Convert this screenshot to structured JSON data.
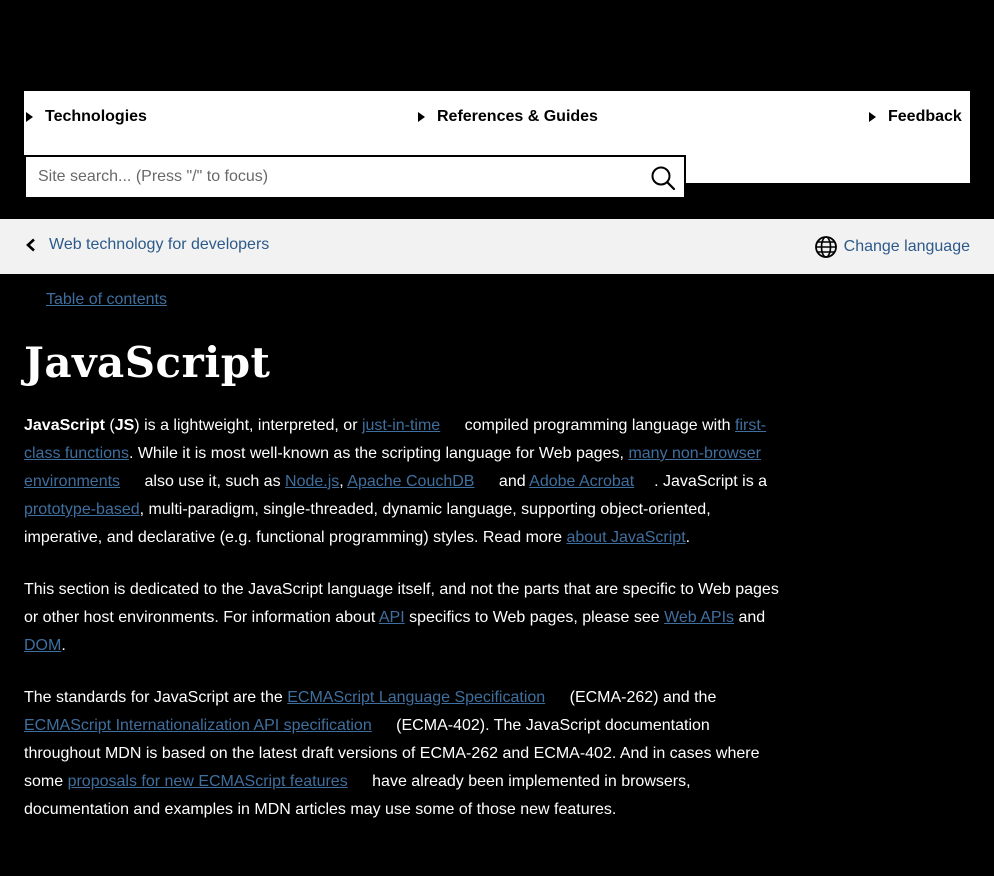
{
  "nav": {
    "technologies": "Technologies",
    "references": "References & Guides",
    "feedback": "Feedback"
  },
  "search": {
    "placeholder": "Site search... (Press \"/\" to focus)"
  },
  "breadcrumb": {
    "back_label": "Web technology for developers",
    "change_language": "Change language"
  },
  "toc": {
    "label": "Table of contents"
  },
  "page": {
    "title": "JavaScript"
  },
  "p1": {
    "js_bold": "JavaScript",
    "t1": " (",
    "js_abbr": "JS",
    "t2": ") is a lightweight, interpreted, or ",
    "jit": "just-in-time",
    "t3": " compiled programming language with ",
    "fcf": "first-class functions",
    "t4": ". While it is most well-known as the scripting language for Web pages, ",
    "nonbrowser": "many non-browser environments",
    "t5": " also use it, such as ",
    "node": "Node.js",
    "t6": ", ",
    "couch": "Apache CouchDB",
    "t7": " and ",
    "acrobat": "Adobe Acrobat",
    "t8": ". JavaScript is a ",
    "proto": "prototype-based",
    "t9": ", multi-paradigm, single-threaded, dynamic language, supporting object-oriented, imperative, and declarative (e.g. functional programming) styles. Read more ",
    "about": "about JavaScript",
    "t10": "."
  },
  "p2": {
    "t1": "This section is dedicated to the JavaScript language itself, and not the parts that are specific to Web pages or other host environments. For information about ",
    "api": "API",
    "t2": " specifics to Web pages, please see ",
    "webapis": "Web APIs",
    "t3": " and ",
    "dom": "DOM",
    "t4": "."
  },
  "p3": {
    "t1": "The standards for JavaScript are the ",
    "ecmaspec": "ECMAScript Language Specification",
    "t2": " (ECMA-262) and the ",
    "intlspec": "ECMAScript Internationalization API specification",
    "t3": " (ECMA-402). The JavaScript documentation throughout MDN is based on the latest draft versions of ECMA-262 and ECMA-402. And in cases where some ",
    "proposals": "proposals for new ECMAScript features",
    "t4": " have already been implemented in browsers, documentation and examples in MDN articles may use some of those new features."
  },
  "colors": {
    "background": "#000000",
    "link": "#3f6f9f",
    "nav_bg": "#ffffff",
    "breadcrumb_bg": "#f2f2f2"
  }
}
